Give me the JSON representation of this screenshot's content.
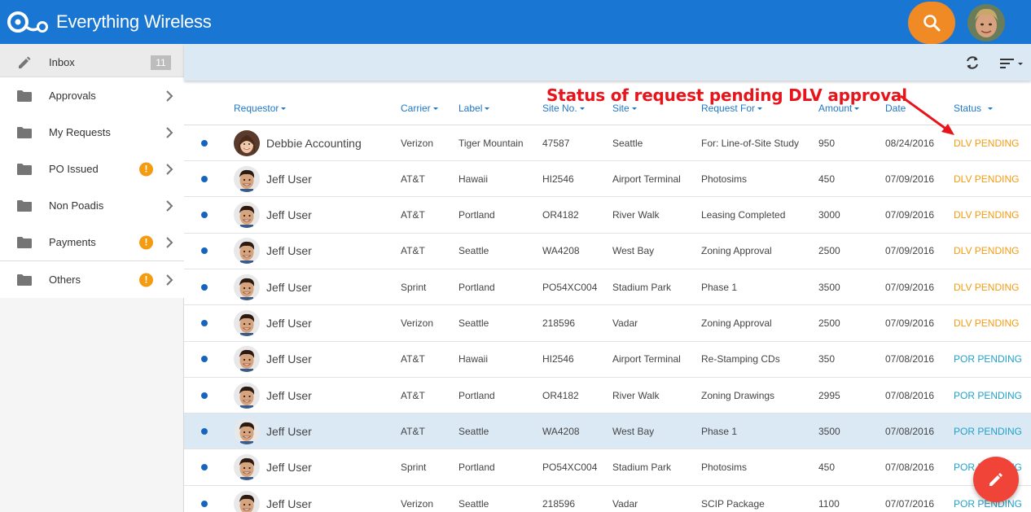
{
  "app": {
    "title": "Everything Wireless"
  },
  "topbar": {
    "search_icon": "search-icon",
    "accent_color": "#ef8a25",
    "bar_color": "#1976d2"
  },
  "sidebar": {
    "items": [
      {
        "label": "Inbox",
        "icon": "pencil-icon",
        "count": "11"
      },
      {
        "label": "Approvals",
        "icon": "folder-icon"
      },
      {
        "label": "My Requests",
        "icon": "folder-icon"
      },
      {
        "label": "PO Issued",
        "icon": "folder-icon",
        "alert": "!"
      },
      {
        "label": "Non Poadis",
        "icon": "folder-icon"
      },
      {
        "label": "Payments",
        "icon": "folder-icon",
        "alert": "!"
      },
      {
        "label": "Others",
        "icon": "folder-icon",
        "alert": "!"
      }
    ]
  },
  "table": {
    "columns": [
      "Requestor",
      "Carrier",
      "Label",
      "Site No.",
      "Site",
      "Request For",
      "Amount",
      "Date",
      "Status"
    ],
    "rows": [
      {
        "requestor": "Debbie Accounting",
        "carrier": "Verizon",
        "label": "Tiger Mountain",
        "site_no": "47587",
        "site": "Seattle",
        "request_for": "For: Line-of-Site Study",
        "amount": "950",
        "date": "08/24/2016",
        "status": "DLV PENDING"
      },
      {
        "requestor": "Jeff User",
        "carrier": "AT&T",
        "label": "Hawaii",
        "site_no": "HI2546",
        "site": "Airport Terminal",
        "request_for": "Photosims",
        "amount": "450",
        "date": "07/09/2016",
        "status": "DLV PENDING"
      },
      {
        "requestor": "Jeff User",
        "carrier": "AT&T",
        "label": "Portland",
        "site_no": "OR4182",
        "site": "River Walk",
        "request_for": "Leasing Completed",
        "amount": "3000",
        "date": "07/09/2016",
        "status": "DLV PENDING"
      },
      {
        "requestor": "Jeff User",
        "carrier": "AT&T",
        "label": "Seattle",
        "site_no": "WA4208",
        "site": "West Bay",
        "request_for": "Zoning Approval",
        "amount": "2500",
        "date": "07/09/2016",
        "status": "DLV PENDING"
      },
      {
        "requestor": "Jeff User",
        "carrier": "Sprint",
        "label": "Portland",
        "site_no": "PO54XC004",
        "site": "Stadium Park",
        "request_for": "Phase 1",
        "amount": "3500",
        "date": "07/09/2016",
        "status": "DLV PENDING"
      },
      {
        "requestor": "Jeff User",
        "carrier": "Verizon",
        "label": "Seattle",
        "site_no": "218596",
        "site": "Vadar",
        "request_for": "Zoning Approval",
        "amount": "2500",
        "date": "07/09/2016",
        "status": "DLV PENDING"
      },
      {
        "requestor": "Jeff User",
        "carrier": "AT&T",
        "label": "Hawaii",
        "site_no": "HI2546",
        "site": "Airport Terminal",
        "request_for": "Re-Stamping CDs",
        "amount": "350",
        "date": "07/08/2016",
        "status": "POR PENDING"
      },
      {
        "requestor": "Jeff User",
        "carrier": "AT&T",
        "label": "Portland",
        "site_no": "OR4182",
        "site": "River Walk",
        "request_for": "Zoning Drawings",
        "amount": "2995",
        "date": "07/08/2016",
        "status": "POR PENDING"
      },
      {
        "requestor": "Jeff User",
        "carrier": "AT&T",
        "label": "Seattle",
        "site_no": "WA4208",
        "site": "West Bay",
        "request_for": "Phase 1",
        "amount": "3500",
        "date": "07/08/2016",
        "status": "POR PENDING",
        "selected": true
      },
      {
        "requestor": "Jeff User",
        "carrier": "Sprint",
        "label": "Portland",
        "site_no": "PO54XC004",
        "site": "Stadium Park",
        "request_for": "Photosims",
        "amount": "450",
        "date": "07/08/2016",
        "status": "POR PENDING"
      },
      {
        "requestor": "Jeff User",
        "carrier": "Verizon",
        "label": "Seattle",
        "site_no": "218596",
        "site": "Vadar",
        "request_for": "SCIP Package",
        "amount": "1100",
        "date": "07/07/2016",
        "status": "POR PENDING"
      }
    ]
  },
  "annotation": {
    "text": "Status of request pending DLV approval",
    "color": "#e8141b"
  },
  "colors": {
    "dlv_pending": "#f39c12",
    "por_pending": "#21a1c9",
    "fab": "#f04438",
    "selected_row": "#dbe9f5"
  }
}
